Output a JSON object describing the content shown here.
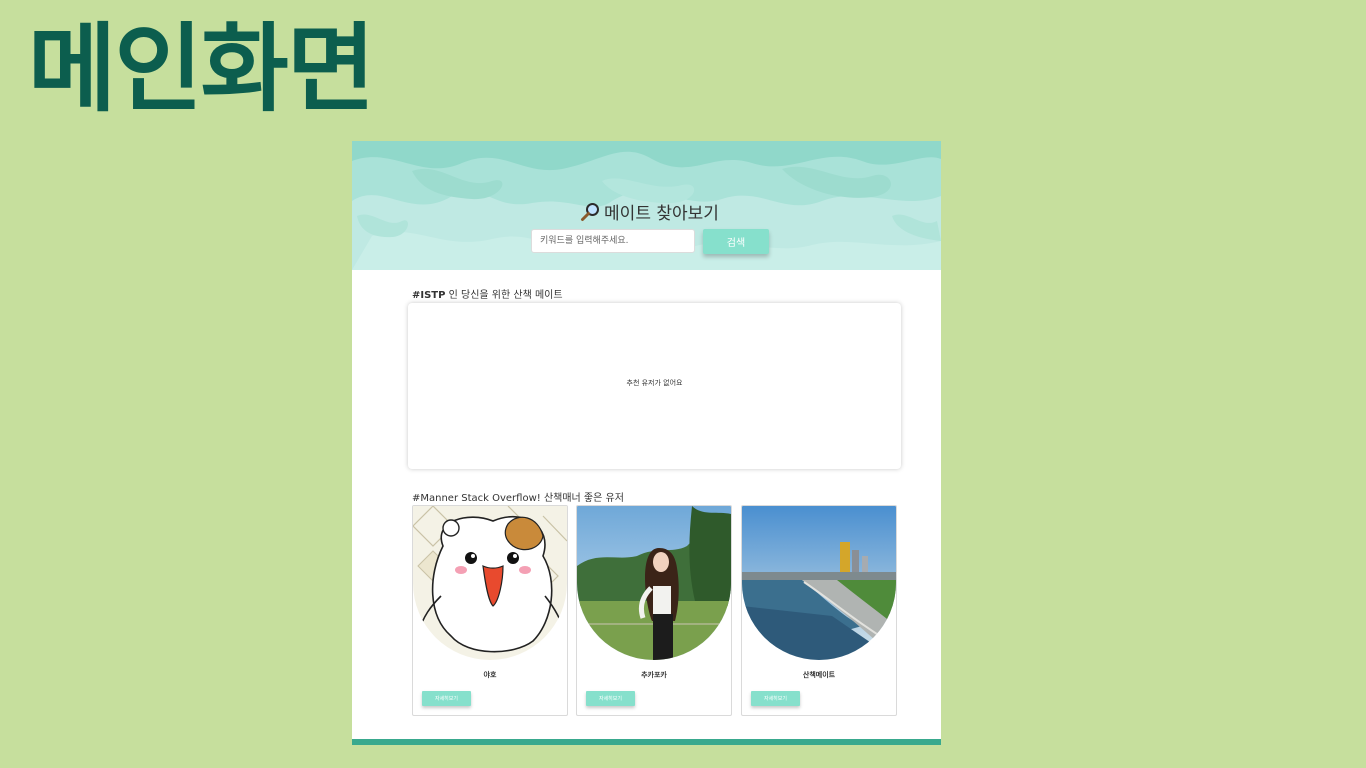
{
  "slide": {
    "title": "메인화면"
  },
  "hero": {
    "title": "메이트 찾아보기",
    "search_placeholder": "키워드를 입력해주세요.",
    "search_button": "검색"
  },
  "recommend": {
    "tag": "#ISTP",
    "heading_rest": " 인 당신을 위한 산책 메이트",
    "empty_text": "추천 유저가 없어요"
  },
  "manner": {
    "heading": "#Manner Stack Overflow! 산책매너 좋은 유저",
    "cards": [
      {
        "name": "야호",
        "button": "자세히보기"
      },
      {
        "name": "추카포카",
        "button": "자세히보기"
      },
      {
        "name": "산책메이트",
        "button": "자세히보기"
      }
    ]
  },
  "colors": {
    "page_bg": "#c6df9d",
    "title": "#0c5e4e",
    "accent": "#86e0cc",
    "footer": "#39a98e"
  },
  "icons": {
    "search": "magnifier-icon"
  }
}
